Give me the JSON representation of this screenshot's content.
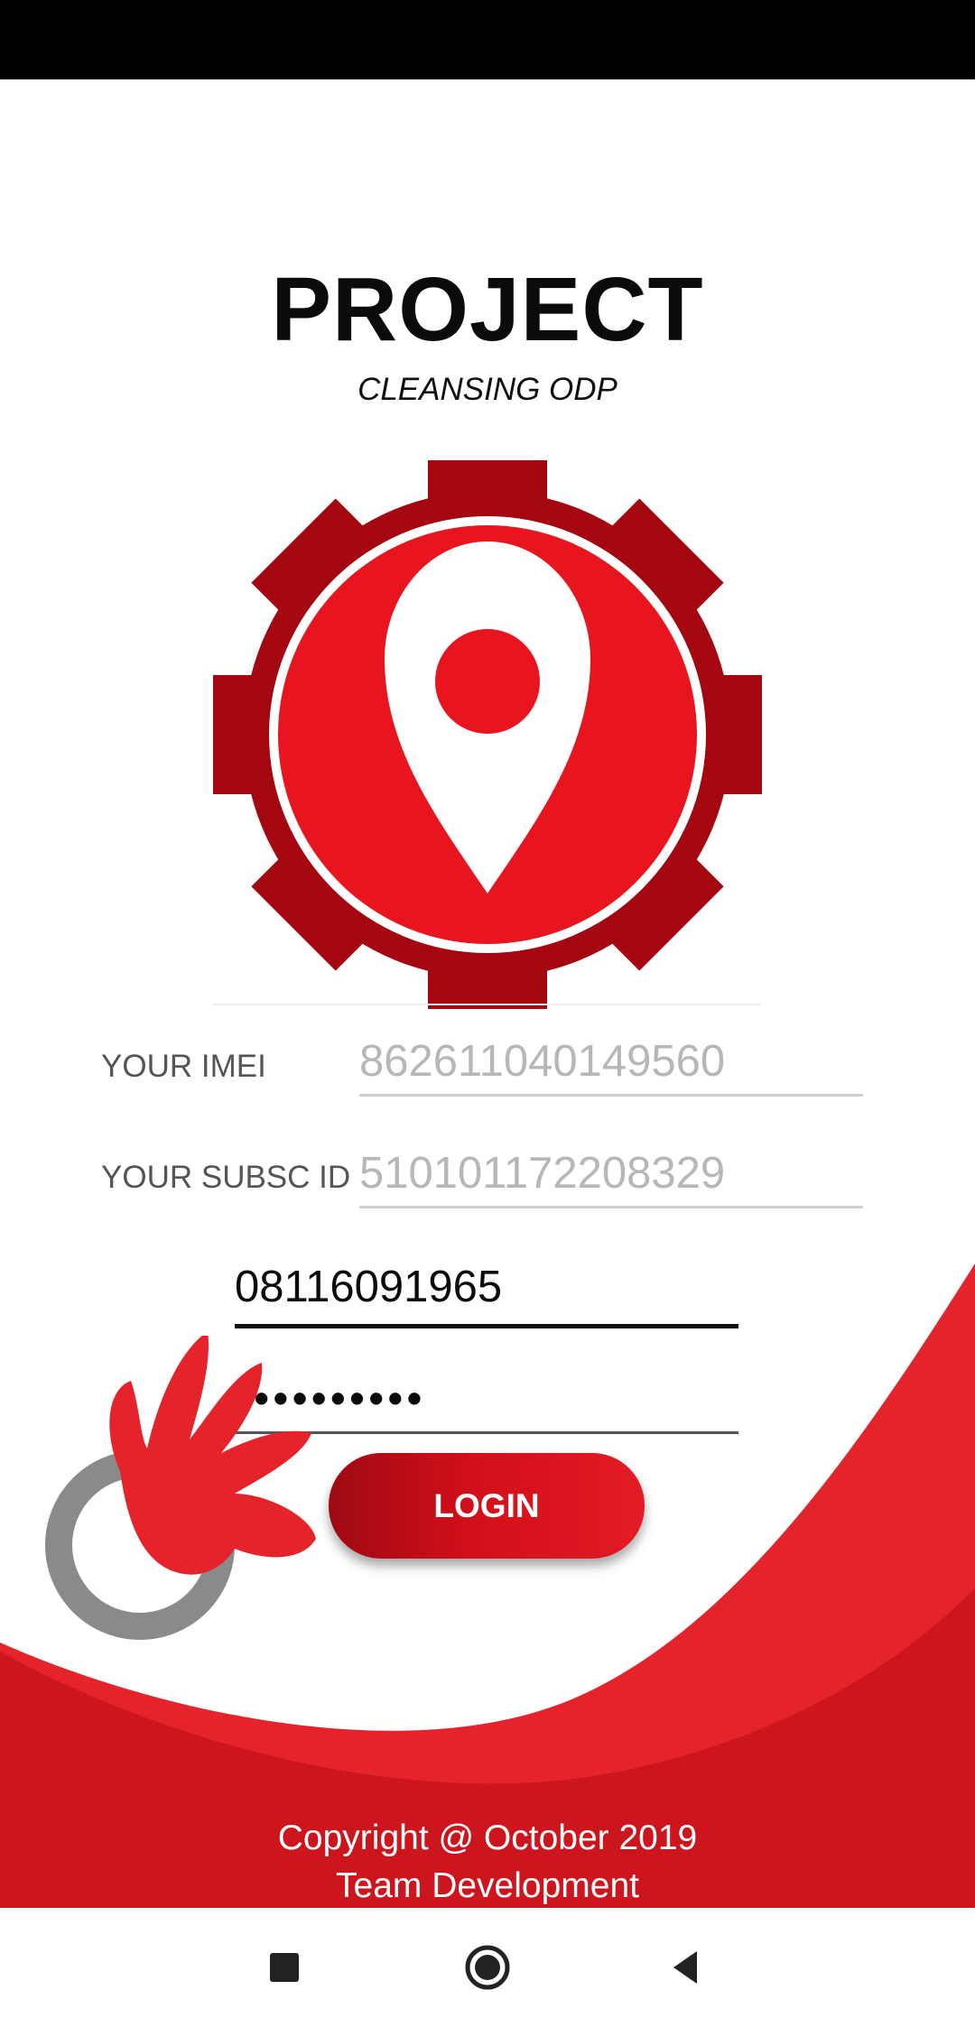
{
  "header": {
    "title": "PROJECT",
    "subtitle": "CLEANSING ODP"
  },
  "form": {
    "imei": {
      "label": "YOUR IMEI",
      "value": "862611040149560"
    },
    "subsc": {
      "label": "YOUR SUBSC ID",
      "value": "510101172208329"
    },
    "phone_value": "08116091965",
    "password_masked": "••••••••••",
    "login_label": "LOGIN"
  },
  "footer": {
    "copyright": "Copyright @ October 2019",
    "team": "Team Development"
  },
  "nav": {
    "recent_icon": "square-icon",
    "home_icon": "circle-icon",
    "back_icon": "triangle-back-icon"
  },
  "colors": {
    "brand_red": "#e8151f",
    "dark_red": "#a50710",
    "wave_red": "#cd151d"
  }
}
